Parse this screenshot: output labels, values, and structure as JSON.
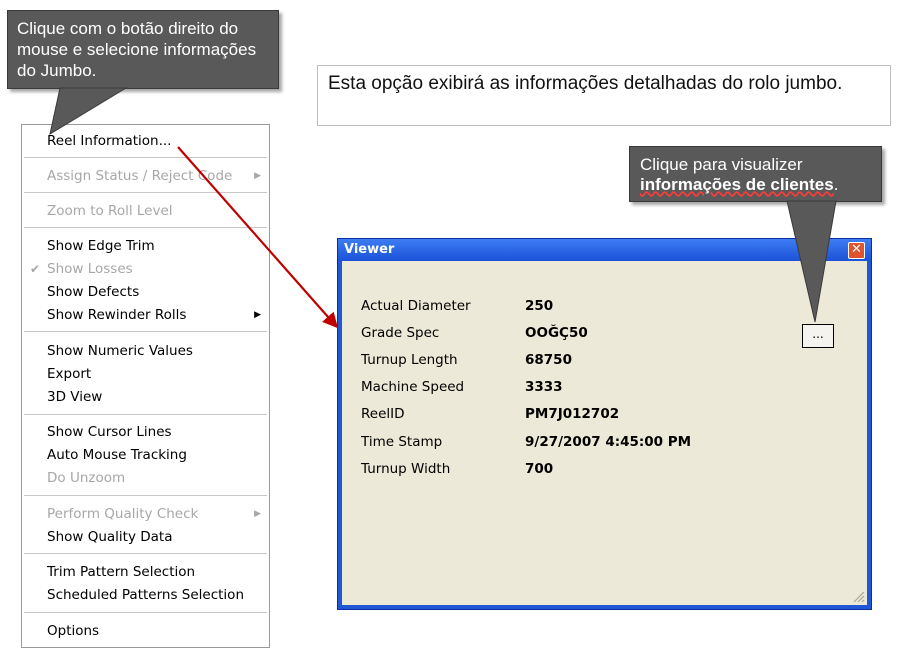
{
  "callouts": {
    "right_click": {
      "text": "Clique com o botão direito do mouse e selecione informações do Jumbo."
    },
    "clients": {
      "line1": "Clique para visualizer",
      "bold": "informações de clientes",
      "suffix": "."
    }
  },
  "info_box": {
    "text": "Esta opção exibirá as informações detalhadas do rolo jumbo."
  },
  "context_menu": {
    "items": [
      {
        "label": "Reel Information...",
        "enabled": true
      },
      {
        "label": "Assign Status / Reject Code",
        "enabled": false,
        "submenu": true
      },
      {
        "label": "Zoom to Roll Level",
        "enabled": false
      },
      {
        "label": "Show Edge Trim",
        "enabled": true
      },
      {
        "label": "Show Losses",
        "enabled": false,
        "checked": true
      },
      {
        "label": "Show Defects",
        "enabled": true
      },
      {
        "label": "Show Rewinder Rolls",
        "enabled": true,
        "submenu": true
      },
      {
        "label": "Show Numeric Values",
        "enabled": true
      },
      {
        "label": "Export",
        "enabled": true
      },
      {
        "label": "3D View",
        "enabled": true
      },
      {
        "label": "Show Cursor Lines",
        "enabled": true
      },
      {
        "label": "Auto Mouse Tracking",
        "enabled": true
      },
      {
        "label": "Do Unzoom",
        "enabled": false
      },
      {
        "label": "Perform Quality Check",
        "enabled": false,
        "submenu": true
      },
      {
        "label": "Show Quality Data",
        "enabled": true
      },
      {
        "label": "Trim Pattern Selection",
        "enabled": true
      },
      {
        "label": "Scheduled Patterns Selection",
        "enabled": true
      },
      {
        "label": "Options",
        "enabled": true
      }
    ]
  },
  "viewer": {
    "title": "Viewer",
    "close_glyph": "✕",
    "details_button": "...",
    "fields": [
      {
        "label": "Actual Diameter",
        "value": "250"
      },
      {
        "label": "Grade Spec",
        "value": "ООĞÇ50"
      },
      {
        "label": "Turnup Length",
        "value": "68750"
      },
      {
        "label": "Machine Speed",
        "value": "3333"
      },
      {
        "label": "ReelID",
        "value": "PM7J012702"
      },
      {
        "label": "Time Stamp",
        "value": "9/27/2007 4:45:00 PM"
      },
      {
        "label": "Turnup Width",
        "value": "700"
      }
    ]
  },
  "icons": {
    "submenu_arrow": "chevron-right-icon",
    "check": "check-icon",
    "close": "close-icon",
    "grip": "resize-grip-icon"
  },
  "colors": {
    "callout_bg": "#595959",
    "arrow": "#c00000",
    "titlebar": "#1f57d6",
    "window_bg": "#ece9d8",
    "disabled_text": "#a7a7a7"
  }
}
